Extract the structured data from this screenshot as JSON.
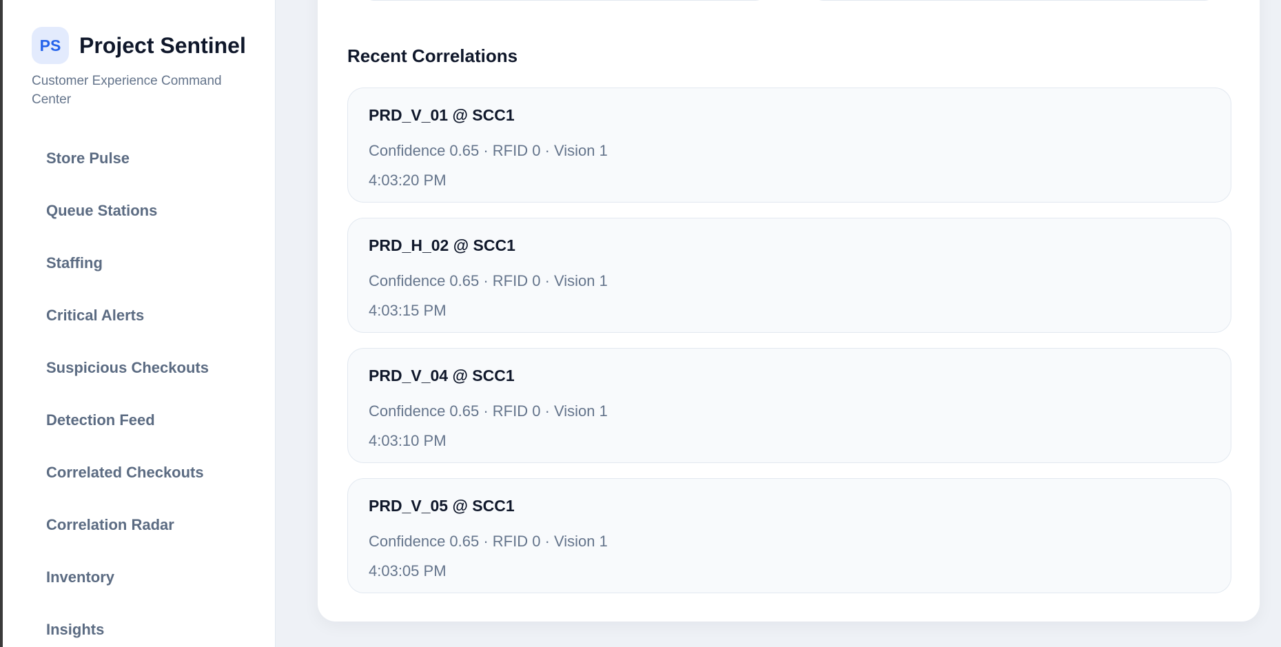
{
  "sidebar": {
    "logo_initials": "PS",
    "title": "Project Sentinel",
    "subtitle": "Customer Experience Command Center",
    "items": [
      {
        "label": "Store Pulse"
      },
      {
        "label": "Queue Stations"
      },
      {
        "label": "Staffing"
      },
      {
        "label": "Critical Alerts"
      },
      {
        "label": "Suspicious Checkouts"
      },
      {
        "label": "Detection Feed"
      },
      {
        "label": "Correlated Checkouts"
      },
      {
        "label": "Correlation Radar"
      },
      {
        "label": "Inventory"
      },
      {
        "label": "Insights"
      }
    ]
  },
  "main": {
    "heading": "Recent Correlations",
    "correlations": [
      {
        "title": "PRD_V_01 @ SCC1",
        "meta": "Confidence 0.65 · RFID 0 · Vision 1",
        "time": "4:03:20 PM"
      },
      {
        "title": "PRD_H_02 @ SCC1",
        "meta": "Confidence 0.65 · RFID 0 · Vision 1",
        "time": "4:03:15 PM"
      },
      {
        "title": "PRD_V_04 @ SCC1",
        "meta": "Confidence 0.65 · RFID 0 · Vision 1",
        "time": "4:03:10 PM"
      },
      {
        "title": "PRD_V_05 @ SCC1",
        "meta": "Confidence 0.65 · RFID 0 · Vision 1",
        "time": "4:03:05 PM"
      }
    ]
  },
  "colors": {
    "accent": "#2563eb",
    "text": "#0f172a",
    "muted": "#64748b",
    "background": "#eef1f6"
  }
}
